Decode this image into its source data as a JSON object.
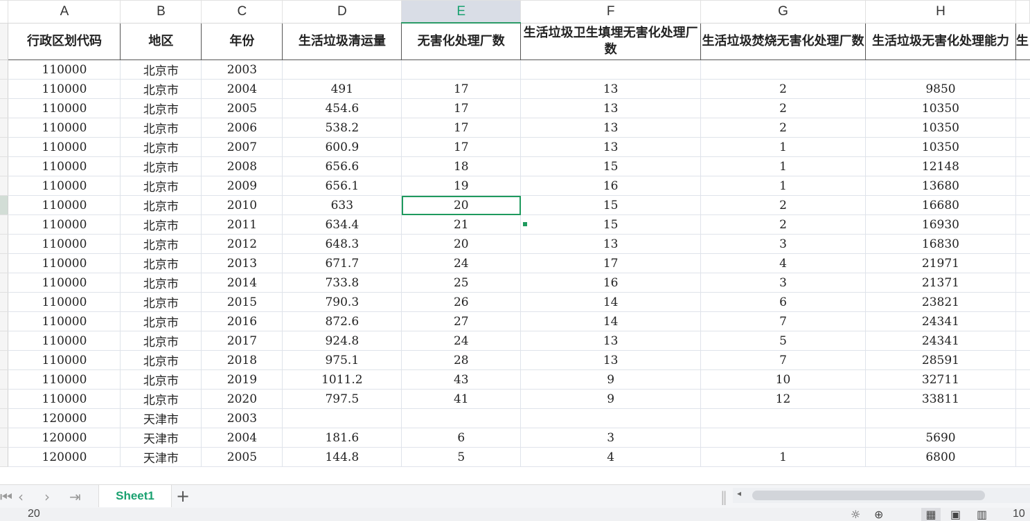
{
  "columns": [
    {
      "letter": "A"
    },
    {
      "letter": "B"
    },
    {
      "letter": "C"
    },
    {
      "letter": "D"
    },
    {
      "letter": "E"
    },
    {
      "letter": "F"
    },
    {
      "letter": "G"
    },
    {
      "letter": "H"
    },
    {
      "letter": ""
    }
  ],
  "header_row": [
    "行政区划代码",
    "地区",
    "年份",
    "生活垃圾清运量",
    "无害化处理厂数",
    "生活垃圾卫生填埋无害化处理厂数",
    "生活垃圾焚烧无害化处理厂数",
    "生活垃圾无害化处理能力",
    "生"
  ],
  "rows": [
    [
      "110000",
      "北京市",
      "2003",
      "",
      "",
      "",
      "",
      ""
    ],
    [
      "110000",
      "北京市",
      "2004",
      "491",
      "17",
      "13",
      "2",
      "9850"
    ],
    [
      "110000",
      "北京市",
      "2005",
      "454.6",
      "17",
      "13",
      "2",
      "10350"
    ],
    [
      "110000",
      "北京市",
      "2006",
      "538.2",
      "17",
      "13",
      "2",
      "10350"
    ],
    [
      "110000",
      "北京市",
      "2007",
      "600.9",
      "17",
      "13",
      "1",
      "10350"
    ],
    [
      "110000",
      "北京市",
      "2008",
      "656.6",
      "18",
      "15",
      "1",
      "12148"
    ],
    [
      "110000",
      "北京市",
      "2009",
      "656.1",
      "19",
      "16",
      "1",
      "13680"
    ],
    [
      "110000",
      "北京市",
      "2010",
      "633",
      "20",
      "15",
      "2",
      "16680"
    ],
    [
      "110000",
      "北京市",
      "2011",
      "634.4",
      "21",
      "15",
      "2",
      "16930"
    ],
    [
      "110000",
      "北京市",
      "2012",
      "648.3",
      "20",
      "13",
      "3",
      "16830"
    ],
    [
      "110000",
      "北京市",
      "2013",
      "671.7",
      "24",
      "17",
      "4",
      "21971"
    ],
    [
      "110000",
      "北京市",
      "2014",
      "733.8",
      "25",
      "16",
      "3",
      "21371"
    ],
    [
      "110000",
      "北京市",
      "2015",
      "790.3",
      "26",
      "14",
      "6",
      "23821"
    ],
    [
      "110000",
      "北京市",
      "2016",
      "872.6",
      "27",
      "14",
      "7",
      "24341"
    ],
    [
      "110000",
      "北京市",
      "2017",
      "924.8",
      "24",
      "13",
      "5",
      "24341"
    ],
    [
      "110000",
      "北京市",
      "2018",
      "975.1",
      "28",
      "13",
      "7",
      "28591"
    ],
    [
      "110000",
      "北京市",
      "2019",
      "1011.2",
      "43",
      "9",
      "10",
      "32711"
    ],
    [
      "110000",
      "北京市",
      "2020",
      "797.5",
      "41",
      "9",
      "12",
      "33811"
    ],
    [
      "120000",
      "天津市",
      "2003",
      "",
      "",
      "",
      "",
      ""
    ],
    [
      "120000",
      "天津市",
      "2004",
      "181.6",
      "6",
      "3",
      "",
      "5690"
    ],
    [
      "120000",
      "天津市",
      "2005",
      "144.8",
      "5",
      "4",
      "1",
      "6800"
    ]
  ],
  "selection": {
    "column": "E",
    "row_index": 7,
    "value": "20"
  },
  "sheet_tab": "Sheet1",
  "status": {
    "value": "20",
    "zoom": "10"
  },
  "colors": {
    "accent": "#1aa170",
    "selected_header": "#d9dde6"
  }
}
